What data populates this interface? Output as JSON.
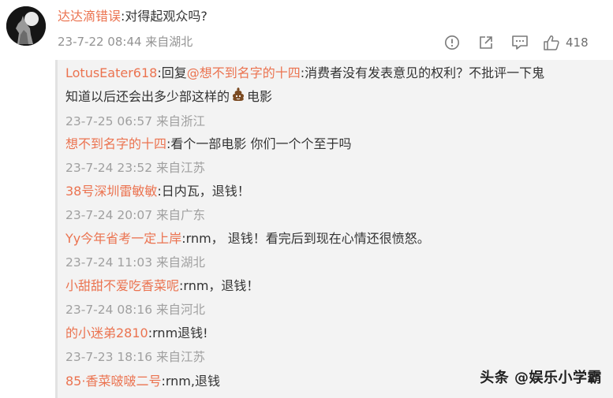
{
  "comment": {
    "username": "达达滴错误",
    "text": ":对得起观众吗?",
    "timestamp": "23-7-22 08:44 来自湖北",
    "like_count": "418",
    "avatar_icon": "howling-wolf-avatar"
  },
  "actions": {
    "report_icon": "alert-circle-icon",
    "share_icon": "share-icon",
    "reply_icon": "comment-icon",
    "like_icon": "thumbs-up-icon"
  },
  "replies": [
    {
      "username": "LotusEater618",
      "prefix": ":回复",
      "mention": "@想不到名字的十四",
      "text_line1": ":消费者没有发表意见的权利？不批评一下鬼",
      "text_line2_before": "知道以后还会出多少部这样的",
      "emoji": "poop-emoji",
      "text_line2_after": "电影",
      "meta": "23-7-25 06:57 来自浙江"
    },
    {
      "username": "想不到名字的十四",
      "text": ":看个一部电影 你们一个个至于吗",
      "meta": "23-7-24 23:52 来自江苏"
    },
    {
      "username": "38号深圳雷敏敏",
      "text": ":日内瓦，退钱！",
      "meta": "23-7-24 20:07 来自广东"
    },
    {
      "username": "Yy今年省考一定上岸",
      "text": ":rnm， 退钱！看完后到现在心情还很愤怒。",
      "meta": "23-7-24 11:03 来自湖北"
    },
    {
      "username": "小甜甜不爱吃香菜呢",
      "text": ":rnm，退钱！",
      "meta": "23-7-24 08:16 来自河北"
    },
    {
      "username": "的小迷弟2810",
      "text": ":rnm退钱!",
      "meta": "23-7-23 18:16 来自江苏"
    },
    {
      "username": "85·香菜啵啵二号",
      "text": ":rnm,退钱",
      "meta": ""
    }
  ],
  "watermark": "头条 @娱乐小学霸",
  "colors": {
    "link": "#eb7350",
    "meta": "#a0a0a0",
    "reply_bg": "#f3f3f3"
  }
}
